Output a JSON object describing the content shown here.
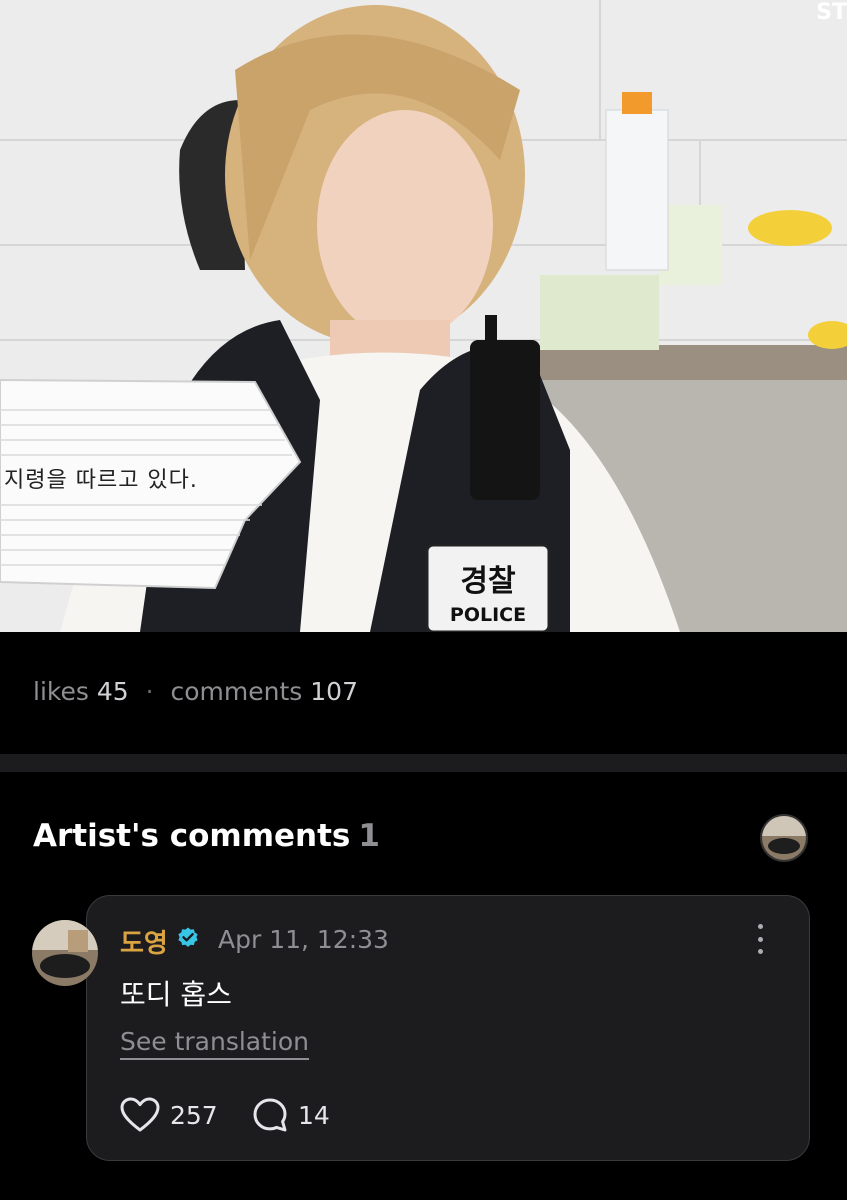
{
  "media": {
    "caption_text": "지령을 따르고 있다.",
    "patch_label": "경찰",
    "patch_sub": "POLICE",
    "watermark": "ST"
  },
  "stats": {
    "likes_label": "likes",
    "likes_count": "45",
    "separator": "·",
    "comments_label": "comments",
    "comments_count": "107"
  },
  "artist_comments": {
    "title": "Artist's comments",
    "count": "1",
    "comment": {
      "author": "도영",
      "verified_icon": "verified-badge-icon",
      "timestamp": "Apr 11, 12:33",
      "body": "또디 홉스",
      "see_translation": "See translation",
      "like_count": "257",
      "reply_count": "14"
    }
  },
  "colors": {
    "background": "#000000",
    "card": "#1c1c1e",
    "author": "#d9a441",
    "muted": "#8e8e93",
    "verified": "#39c5e6"
  }
}
